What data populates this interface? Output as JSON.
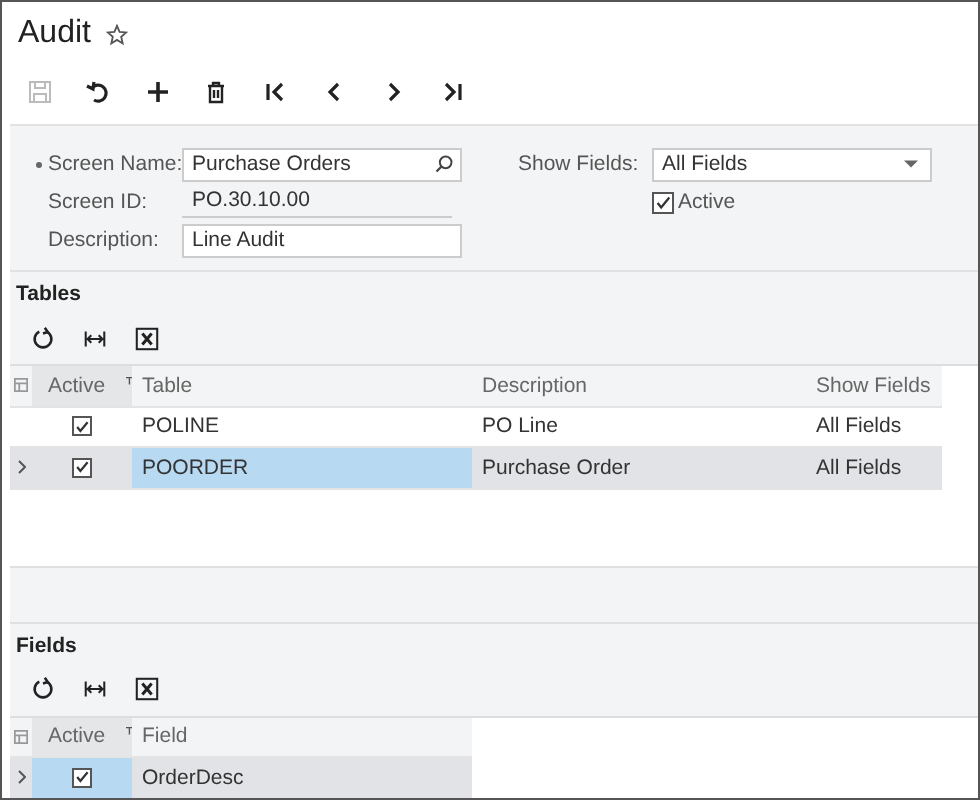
{
  "title": "Audit",
  "toolbar": [
    {
      "kind": "save",
      "disabled": true
    },
    {
      "kind": "undo",
      "disabled": false
    },
    {
      "kind": "add",
      "disabled": false
    },
    {
      "kind": "delete",
      "disabled": false
    },
    {
      "kind": "first",
      "disabled": false
    },
    {
      "kind": "prev",
      "disabled": false
    },
    {
      "kind": "next",
      "disabled": false
    },
    {
      "kind": "last",
      "disabled": false
    }
  ],
  "form": {
    "screen_name": {
      "label": "Screen Name:",
      "value": "Purchase Orders",
      "required": true
    },
    "screen_id": {
      "label": "Screen ID:",
      "value": "PO.30.10.00"
    },
    "description": {
      "label": "Description:",
      "value": "Line Audit"
    },
    "show_fields": {
      "label": "Show Fields:",
      "value": "All Fields"
    },
    "active": {
      "label": "Active",
      "checked": true
    }
  },
  "tables": {
    "title": "Tables",
    "toolbar": [
      {
        "kind": "refresh"
      },
      {
        "kind": "fit"
      },
      {
        "kind": "excel"
      }
    ],
    "columns": [
      "Active",
      "Table",
      "Description",
      "Show Fields"
    ],
    "rows": [
      {
        "selected": false,
        "cells": [
          {
            "kind": "checkbox",
            "checked": true,
            "focused": false
          },
          {
            "kind": "text",
            "text": "POLINE",
            "focused": false
          },
          {
            "kind": "text",
            "text": "PO Line",
            "focused": false
          },
          {
            "kind": "text",
            "text": "All Fields",
            "focused": false
          }
        ]
      },
      {
        "selected": true,
        "cells": [
          {
            "kind": "checkbox",
            "checked": true,
            "focused": false
          },
          {
            "kind": "text",
            "text": "POORDER",
            "focused": true
          },
          {
            "kind": "text",
            "text": "Purchase Order",
            "focused": false
          },
          {
            "kind": "text",
            "text": "All Fields",
            "focused": false
          }
        ]
      }
    ]
  },
  "fields": {
    "title": "Fields",
    "toolbar": [
      {
        "kind": "refresh"
      },
      {
        "kind": "fit"
      },
      {
        "kind": "excel"
      }
    ],
    "columns": [
      "Active",
      "Field"
    ],
    "rows": [
      {
        "selected": true,
        "cells": [
          {
            "kind": "checkbox",
            "checked": true,
            "focused": true
          },
          {
            "kind": "text",
            "text": "OrderDesc",
            "focused": false
          }
        ]
      }
    ]
  }
}
